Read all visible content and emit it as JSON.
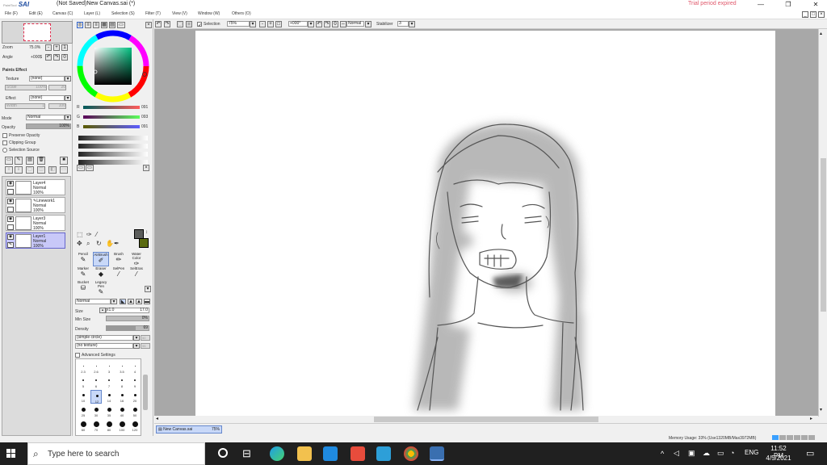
{
  "app": {
    "logo": "SAI",
    "logo_prefix": "PaintTool",
    "window_title": "(Not Saved)New Canvas.sai (*)",
    "trial_notice": "Trial period expired"
  },
  "window_controls": {
    "minimize": "—",
    "maximize": "❐",
    "close": "✕"
  },
  "menu": [
    {
      "label": "File (F)"
    },
    {
      "label": "Edit (E)"
    },
    {
      "label": "Canvas (C)"
    },
    {
      "label": "Layer (L)"
    },
    {
      "label": "Selection (S)"
    },
    {
      "label": "Filter (T)"
    },
    {
      "label": "View (V)"
    },
    {
      "label": "Window (W)"
    },
    {
      "label": "Others (O)"
    }
  ],
  "navigator": {
    "zoom_label": "Zoom",
    "zoom_value": "75.0%",
    "angle_label": "Angle",
    "angle_value": "+000$"
  },
  "paint_effect": {
    "header": "Paints Effect",
    "texture_label": "Texture",
    "texture_value": "(none)",
    "scale_label": "Scale",
    "scale_value": "100%",
    "scale_num": "20",
    "effect_label": "Effect",
    "effect_value": "(none)",
    "width_label": "Width",
    "width_num": "1",
    "width_max": "100"
  },
  "layer_props": {
    "mode_label": "Mode",
    "mode_value": "Normal",
    "opacity_label": "Opacity",
    "opacity_value": "100%",
    "opacity_level": 1.0,
    "preserve_opacity": "Preserve Opacity",
    "clipping_group": "Clipping Group",
    "selection_source": "Selection Source"
  },
  "layers": [
    {
      "name": "Layer4",
      "mode": "Normal",
      "opacity": "100%",
      "selected": false
    },
    {
      "name": "Linework1",
      "mode": "Normal",
      "opacity": "100%",
      "selected": false
    },
    {
      "name": "Layer3",
      "mode": "Normal",
      "opacity": "100%",
      "selected": false
    },
    {
      "name": "Layer1",
      "mode": "Normal",
      "opacity": "100%",
      "selected": true
    }
  ],
  "color": {
    "r_label": "R",
    "r_value": "091",
    "g_label": "G",
    "g_value": "093",
    "b_label": "B",
    "b_value": "091",
    "primary": "#5b5d5b",
    "secondary": "#5a6a10"
  },
  "tools": [
    {
      "label": "Pencil",
      "icon": "pencil-icon"
    },
    {
      "label": "AirBrush",
      "icon": "airbrush-icon",
      "selected": true
    },
    {
      "label": "Brush",
      "icon": "brush-icon"
    },
    {
      "label": "Water Color",
      "icon": "watercolor-icon"
    },
    {
      "label": "Marker",
      "icon": "marker-icon"
    },
    {
      "label": "Eraser",
      "icon": "eraser-icon"
    },
    {
      "label": "SelPen",
      "icon": "selpen-icon"
    },
    {
      "label": "SelEras",
      "icon": "seleras-icon"
    },
    {
      "label": "Bucket",
      "icon": "bucket-icon"
    },
    {
      "label": "Legacy Pen",
      "icon": "legacypen-icon"
    }
  ],
  "brush": {
    "blend_mode": "Normal",
    "size_label": "Size",
    "size_mult": "x1.0",
    "size_value": "17.0",
    "min_size_label": "Min Size",
    "min_size_value": "0%",
    "density_label": "Density",
    "density_value": "69",
    "shape": "(simple circle)",
    "shape_num": "50",
    "texture": "(no texture)",
    "texture_num": "95",
    "advanced": "Advanced Settings"
  },
  "brush_presets": [
    [
      "2.3",
      "2.6",
      "3",
      "3.5",
      "4"
    ],
    [
      "5",
      "6",
      "7",
      "8",
      "9"
    ],
    [
      "10",
      "12",
      "14",
      "16",
      "20"
    ],
    [
      "25",
      "30",
      "35",
      "40",
      "50"
    ],
    [
      "60",
      "70",
      "80",
      "100",
      "120"
    ]
  ],
  "canvas_toolbar": {
    "selection_label": "Selection",
    "zoom_value": "75%",
    "angle_value": "+000°",
    "blend_value": "Normal",
    "stabilizer_label": "Stabilizer",
    "stabilizer_value": "3"
  },
  "document_tab": {
    "name": "New Canvas.sai",
    "zoom": "75%"
  },
  "status": {
    "memory": "Memory Usage: 33% (Use1320MB/Max3972MB)"
  },
  "taskbar": {
    "search_placeholder": "Type here to search",
    "language": "ENG",
    "time": "11:52 PM",
    "date": "4/5/2021"
  }
}
